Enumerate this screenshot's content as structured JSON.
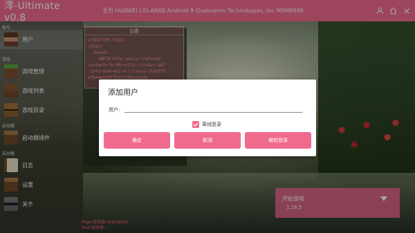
{
  "app": {
    "title": "澪-Ultimate v0.8",
    "device_info": "主页    HUAWEI LIO-AN00 Android 9  Qualcomm Technologies, Inc MSM8998"
  },
  "topbar": {
    "icons": [
      "user-icon",
      "home-icon",
      "close-icon"
    ]
  },
  "sidebar": {
    "groups": [
      {
        "label": "帐号",
        "items": [
          {
            "label": "用户",
            "icon": "user-avatar-icon"
          }
        ]
      },
      {
        "label": "游戏",
        "items": [
          {
            "label": "游戏管理",
            "icon": "grass-block-icon"
          },
          {
            "label": "游戏列表",
            "icon": "dirt-block-icon"
          },
          {
            "label": "游戏目录",
            "icon": "chest-icon"
          }
        ]
      },
      {
        "label": "启动器",
        "items": [
          {
            "label": "启动器插件",
            "icon": "crafting-icon"
          }
        ]
      },
      {
        "label": "启动器",
        "items": [
          {
            "label": "日志",
            "icon": "book-icon"
          },
          {
            "label": "设置",
            "icon": "craft-table-icon"
          },
          {
            "label": "关于",
            "icon": "furnace-icon"
          }
        ]
      }
    ]
  },
  "notice": {
    "title": "公告",
    "body": "<!DOCTYPE html>\n<html>\n  <head>\n    <META http-equiv=\"refresh\"\ncontent=\"0;URL=http://nobar.sbf\n.info/domredirect?rsKaj=Jleb3f3\nafb4ee6d4f7b15rGd9c4g4ab..."
  },
  "launch": {
    "label": "开始游戏",
    "version": "1.16.5"
  },
  "footer": {
    "renderer": "Pojav渲染器:opengles2\nBoat渲染器:..."
  },
  "dialog": {
    "title": "添加用户",
    "field_label": "用户:",
    "username_value": "",
    "offline_checked": true,
    "offline_label": "离线登录",
    "ok_label": "确定",
    "cancel_label": "取消",
    "microsoft_label": "微软登录"
  },
  "colors": {
    "accent": "#f06a8e",
    "dialog_bg": "#ffffff"
  }
}
